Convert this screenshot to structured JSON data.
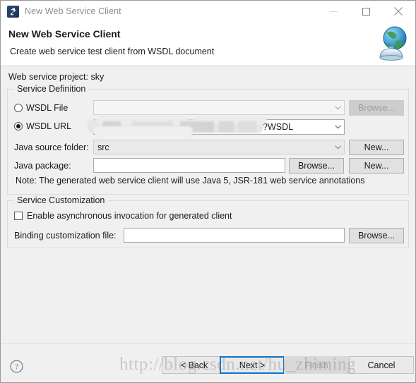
{
  "window": {
    "title": "New Web Service Client",
    "icon": "app-icon",
    "controls": {
      "minimize": "minimize-icon",
      "maximize": "maximize-icon",
      "close": "close-icon"
    }
  },
  "header": {
    "title": "New Web Service Client",
    "subtitle": "Create web service test client from WSDL document",
    "icon": "globe-service-icon"
  },
  "body": {
    "project_label": "Web service project: sky",
    "service_definition": {
      "group_title": "Service Definition",
      "wsdl_file": {
        "radio_label": "WSDL File",
        "selected": false,
        "value": "",
        "browse_label": "Browse...",
        "browse_enabled": false
      },
      "wsdl_url": {
        "radio_label": "WSDL URL",
        "selected": true,
        "value": "?WSDL",
        "redacted": true
      },
      "java_source_folder": {
        "label": "Java source folder:",
        "value": "src",
        "new_label": "New..."
      },
      "java_package": {
        "label": "Java package:",
        "value": "",
        "browse_label": "Browse...",
        "new_label": "New..."
      },
      "note": "Note: The generated web service client will use Java 5, JSR-181 web service annotations"
    },
    "service_customization": {
      "group_title": "Service Customization",
      "async_checkbox": {
        "label": "Enable asynchronous invocation for generated client",
        "checked": false
      },
      "binding_file": {
        "label": "Binding customization file:",
        "value": "",
        "browse_label": "Browse..."
      }
    }
  },
  "footer": {
    "help_icon": "help-icon",
    "buttons": {
      "back": "< Back",
      "next": "Next >",
      "finish": "Finish",
      "cancel": "Cancel"
    },
    "finish_enabled": false,
    "default_button": "Next >"
  },
  "watermark": "http://blog.csdn.net/hu_zhiming",
  "colors": {
    "dialog_bg": "#f0f0f0",
    "header_bg": "#ffffff",
    "accent_focus": "#0a74c8",
    "text": "#1a1a1a",
    "title_text": "#8d8d8d",
    "disabled_text": "#a0a0a0"
  }
}
